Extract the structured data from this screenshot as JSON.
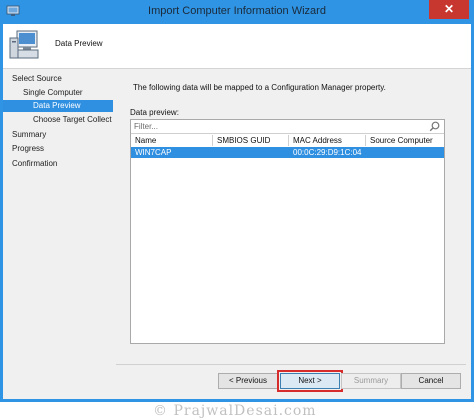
{
  "window": {
    "title": "Import Computer Information Wizard",
    "close_glyph": "✕"
  },
  "header": {
    "title": "Data Preview",
    "icon": "computer-icon"
  },
  "nav": {
    "items": [
      {
        "label": "Select Source"
      },
      {
        "label": "Single Computer"
      },
      {
        "label": "Data Preview"
      },
      {
        "label": "Choose Target Collect"
      },
      {
        "label": "Summary"
      },
      {
        "label": "Progress"
      },
      {
        "label": "Confirmation"
      }
    ],
    "active_color": "#2f8fe0"
  },
  "main": {
    "info_text": "The following data will be mapped to a Configuration Manager property.",
    "preview_label": "Data preview:",
    "filter_placeholder": "Filter...",
    "columns": [
      "Name",
      "SMBIOS GUID",
      "MAC Address",
      "Source Computer"
    ],
    "rows": [
      {
        "name": "WIN7CAP",
        "smbios_guid": "",
        "mac": "00:0C:29:D9:1C:04",
        "source": ""
      }
    ]
  },
  "footer": {
    "previous_label": "< Previous",
    "next_label": "Next >",
    "summary_label": "Summary",
    "cancel_label": "Cancel",
    "watermark": "© PrajwalDesai.com"
  },
  "colors": {
    "titlebar": "#2e94e3",
    "selection": "#2f8fe0",
    "highlight_border": "#d62c2c"
  }
}
